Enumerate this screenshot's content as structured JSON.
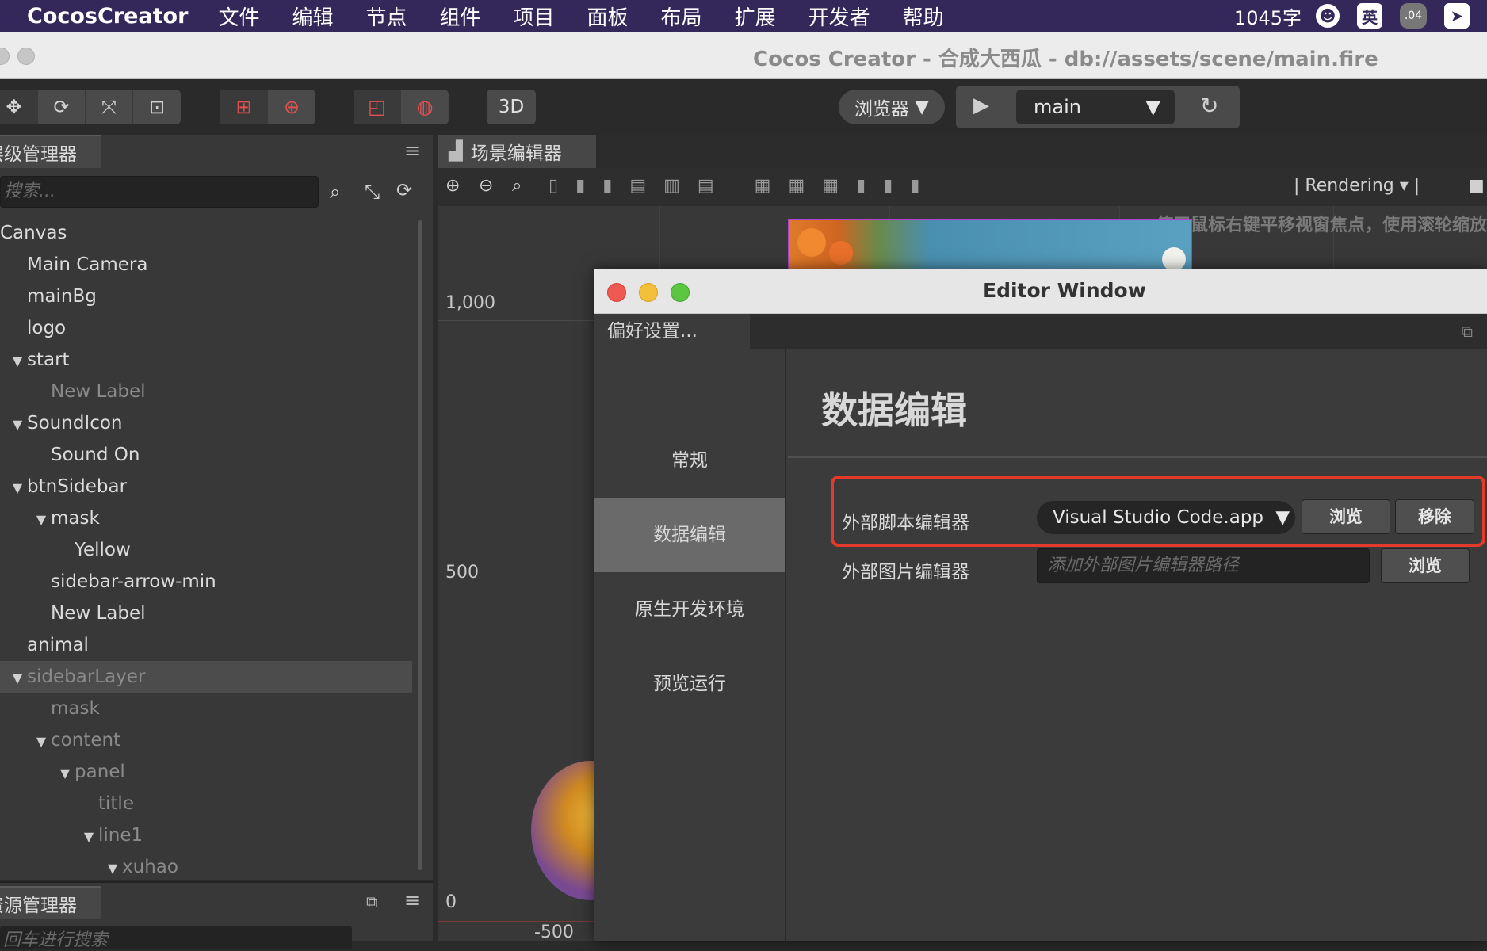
{
  "menubar": {
    "app": "CocosCreator",
    "items": [
      "文件",
      "编辑",
      "节点",
      "组件",
      "项目",
      "面板",
      "布局",
      "扩展",
      "开发者",
      "帮助"
    ],
    "word_count": "1045字",
    "ime": "英",
    "badge": ".04"
  },
  "window": {
    "title": "Cocos Creator - 合成大西瓜 - db://assets/scene/main.fire"
  },
  "toolbar": {
    "mode_3d": "3D",
    "preview_target": "浏览器",
    "scene_select": "main"
  },
  "hierarchy": {
    "tab": "层级管理器",
    "search_placeholder": "搜索...",
    "nodes": [
      {
        "label": "Canvas",
        "depth": 0,
        "arrow": "",
        "dim": false,
        "selected": false
      },
      {
        "label": "Main Camera",
        "depth": 1,
        "arrow": "",
        "dim": false,
        "selected": false
      },
      {
        "label": "mainBg",
        "depth": 1,
        "arrow": "",
        "dim": false,
        "selected": false
      },
      {
        "label": "logo",
        "depth": 1,
        "arrow": "",
        "dim": false,
        "selected": false
      },
      {
        "label": "start",
        "depth": 1,
        "arrow": "▼",
        "dim": false,
        "selected": false
      },
      {
        "label": "New Label",
        "depth": 2,
        "arrow": "",
        "dim": true,
        "selected": false
      },
      {
        "label": "SoundIcon",
        "depth": 1,
        "arrow": "▼",
        "dim": false,
        "selected": false
      },
      {
        "label": "Sound On",
        "depth": 2,
        "arrow": "",
        "dim": false,
        "selected": false
      },
      {
        "label": "btnSidebar",
        "depth": 1,
        "arrow": "▼",
        "dim": false,
        "selected": false
      },
      {
        "label": "mask",
        "depth": 2,
        "arrow": "▼",
        "dim": false,
        "selected": false
      },
      {
        "label": "Yellow",
        "depth": 3,
        "arrow": "",
        "dim": false,
        "selected": false
      },
      {
        "label": "sidebar-arrow-min",
        "depth": 2,
        "arrow": "",
        "dim": false,
        "selected": false
      },
      {
        "label": "New Label",
        "depth": 2,
        "arrow": "",
        "dim": false,
        "selected": false
      },
      {
        "label": "animal",
        "depth": 1,
        "arrow": "",
        "dim": false,
        "selected": false
      },
      {
        "label": "sidebarLayer",
        "depth": 1,
        "arrow": "▼",
        "dim": true,
        "selected": true
      },
      {
        "label": "mask",
        "depth": 2,
        "arrow": "",
        "dim": true,
        "selected": false
      },
      {
        "label": "content",
        "depth": 2,
        "arrow": "▼",
        "dim": true,
        "selected": false
      },
      {
        "label": "panel",
        "depth": 3,
        "arrow": "▼",
        "dim": true,
        "selected": false
      },
      {
        "label": "title",
        "depth": 4,
        "arrow": "",
        "dim": true,
        "selected": false
      },
      {
        "label": "line1",
        "depth": 4,
        "arrow": "▼",
        "dim": true,
        "selected": false
      },
      {
        "label": "xuhao",
        "depth": 5,
        "arrow": "▼",
        "dim": true,
        "selected": false
      }
    ]
  },
  "assets": {
    "tab": "资源管理器",
    "search_placeholder": "回车进行搜索"
  },
  "scene": {
    "tab": "场景编辑器",
    "render_mode": "Rendering",
    "hint": "使用鼠标右键平移视窗焦点，使用滚轮缩放",
    "axis_labels": {
      "y1000": "1,000",
      "y500": "500",
      "y0": "0",
      "xm500": "-500"
    }
  },
  "dialog": {
    "title": "Editor Window",
    "tab": "偏好设置...",
    "nav": [
      "常规",
      "数据编辑",
      "原生开发环境",
      "预览运行"
    ],
    "active_nav": "数据编辑",
    "heading": "数据编辑",
    "script_editor_label": "外部脚本编辑器",
    "script_editor_value": "Visual Studio Code.app",
    "browse": "浏览",
    "remove": "移除",
    "image_editor_label": "外部图片编辑器",
    "image_editor_placeholder": "添加外部图片编辑器路径",
    "browse2": "浏览"
  },
  "colors": {
    "menubar": "#34285a",
    "highlight": "#e53a2a",
    "active_nav": "#6a6a6a"
  }
}
